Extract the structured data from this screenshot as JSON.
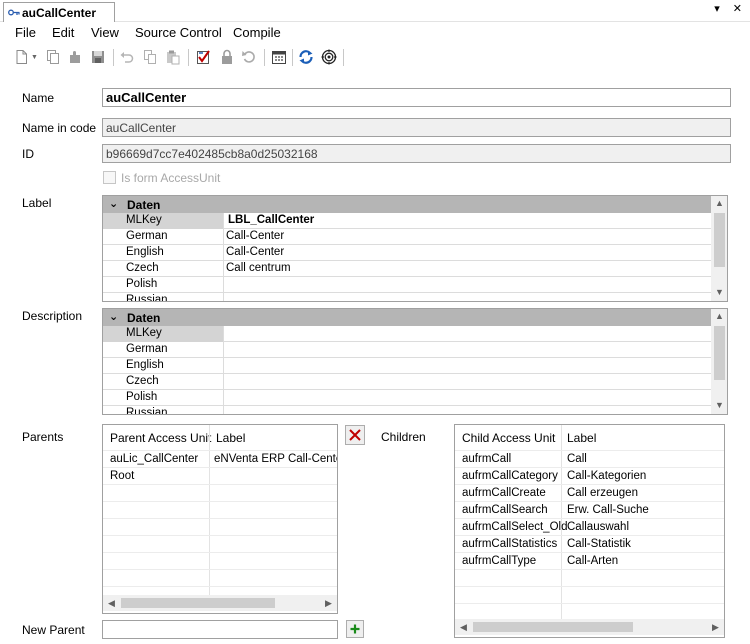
{
  "window": {
    "tab_title": "auCallCenter",
    "tab_arrow": "▾",
    "tab_close": "✕"
  },
  "menu": {
    "items": [
      "File",
      "Edit",
      "View",
      "Source Control",
      "Compile"
    ]
  },
  "toolbar": {
    "icons": [
      "new-document-icon",
      "copy-icon",
      "plugin-icon",
      "save-icon",
      "undo-icon",
      "copy2-icon",
      "paste-icon",
      "checklist-icon",
      "lock-icon",
      "revert-icon",
      "calendar-icon",
      "sync-icon",
      "target-icon"
    ]
  },
  "form": {
    "name_label": "Name",
    "name_value": "auCallCenter",
    "name_in_code_label": "Name in code",
    "name_in_code_value": "auCallCenter",
    "id_label": "ID",
    "id_value": "b96669d7cc7e402485cb8a0d25032168",
    "is_form_label": "Is form AccessUnit",
    "label_label": "Label",
    "description_label": "Description",
    "parents_label": "Parents",
    "children_label": "Children",
    "new_parent_label": "New Parent",
    "new_parent_value": ""
  },
  "label_grid": {
    "group": "Daten",
    "rows": [
      {
        "key": "MLKey",
        "value": "LBL_CallCenter"
      },
      {
        "key": "German",
        "value": "Call-Center"
      },
      {
        "key": "English",
        "value": "Call-Center"
      },
      {
        "key": "Czech",
        "value": "Call centrum"
      },
      {
        "key": "Polish",
        "value": ""
      },
      {
        "key": "Russian",
        "value": ""
      }
    ]
  },
  "description_grid": {
    "group": "Daten",
    "rows": [
      {
        "key": "MLKey",
        "value": ""
      },
      {
        "key": "German",
        "value": ""
      },
      {
        "key": "English",
        "value": ""
      },
      {
        "key": "Czech",
        "value": ""
      },
      {
        "key": "Polish",
        "value": ""
      },
      {
        "key": "Russian",
        "value": ""
      }
    ]
  },
  "parents": {
    "headers": [
      "Parent Access Unit",
      "Label"
    ],
    "rows": [
      [
        "auLic_CallCenter",
        "eNVenta ERP Call-Center"
      ],
      [
        "Root",
        ""
      ]
    ]
  },
  "children": {
    "headers": [
      "Child Access Unit",
      "Label"
    ],
    "rows": [
      [
        "aufrmCall",
        "Call"
      ],
      [
        "aufrmCallCategory",
        "Call-Kategorien"
      ],
      [
        "aufrmCallCreate",
        "Call erzeugen"
      ],
      [
        "aufrmCallSearch",
        "Erw. Call-Suche"
      ],
      [
        "aufrmCallSelect_Old",
        "Callauswahl"
      ],
      [
        "aufrmCallStatistics",
        "Call-Statistik"
      ],
      [
        "aufrmCallType",
        "Call-Arten"
      ]
    ]
  },
  "colors": {
    "group_header": "#b5b5b5",
    "key_selected": "#d4d4d4",
    "delete_red": "#c00000",
    "add_green": "#1a8a1a",
    "sync_blue": "#1c5fb8"
  }
}
